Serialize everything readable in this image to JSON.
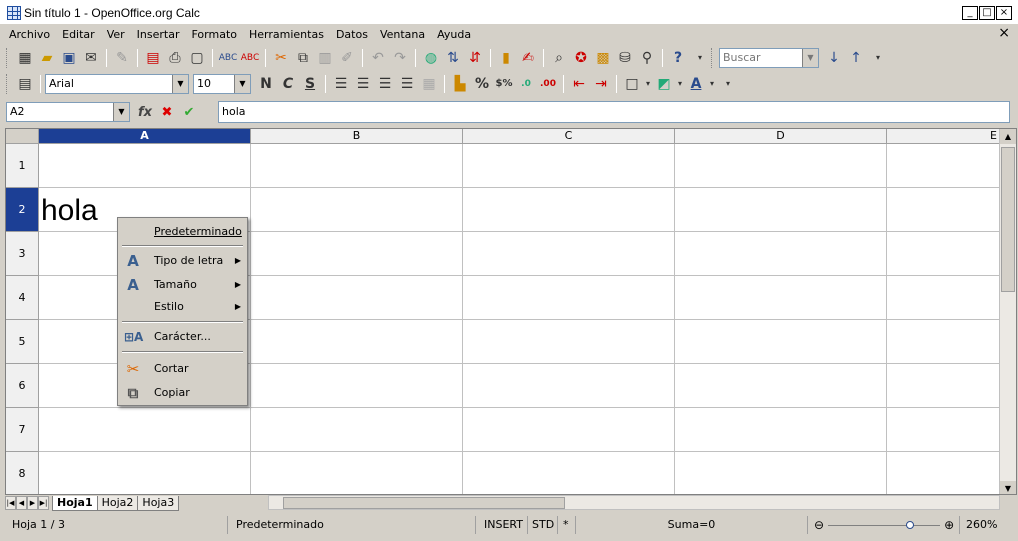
{
  "window": {
    "title": "Sin título 1 - OpenOffice.org Calc",
    "minimize": "_",
    "maximize": "□",
    "close": "×",
    "doc_close": "×"
  },
  "menu": [
    "Archivo",
    "Editar",
    "Ver",
    "Insertar",
    "Formato",
    "Herramientas",
    "Datos",
    "Ventana",
    "Ayuda"
  ],
  "toolbar": {
    "search_placeholder": "Buscar",
    "font_name": "Arial",
    "font_size": "10",
    "bold": "N",
    "italic": "C",
    "underline": "S",
    "percent": "%",
    "currency": "$%",
    "decimal_add": ".0",
    "decimal_del": ".00"
  },
  "formula_bar": {
    "name_box": "A2",
    "fx": "fx",
    "cancel": "✖",
    "accept": "✔",
    "content": "hola"
  },
  "sheet": {
    "columns": [
      "A",
      "B",
      "C",
      "D",
      "E"
    ],
    "rows": [
      "1",
      "2",
      "3",
      "4",
      "5",
      "6",
      "7",
      "8"
    ],
    "selected_column": "A",
    "selected_row": "2",
    "cell_a2": "hola"
  },
  "context_menu": {
    "items": [
      {
        "label": "Predeterminado"
      },
      {
        "label": "Tipo de letra"
      },
      {
        "label": "Tamaño"
      },
      {
        "label": "Estilo"
      },
      {
        "label": "Carácter..."
      },
      {
        "label": "Cortar"
      },
      {
        "label": "Copiar"
      }
    ]
  },
  "tabs": [
    "Hoja1",
    "Hoja2",
    "Hoja3"
  ],
  "status": {
    "sheet": "Hoja 1 / 3",
    "style": "Predeterminado",
    "insert": "INSERT",
    "mode": "STD",
    "modified": "*",
    "sum": "Suma=0",
    "zoom": "260%"
  },
  "colors": {
    "selection": "#1c3f95",
    "chrome": "#d4d0c8"
  }
}
